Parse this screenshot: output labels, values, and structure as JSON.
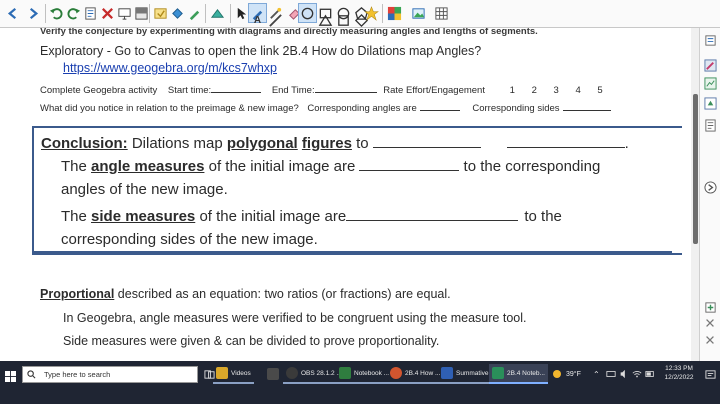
{
  "toolbar": {
    "icons": [
      "back-icon",
      "forward-icon",
      "undo-icon",
      "redo-icon",
      "page-icon",
      "delete-icon",
      "display-icon",
      "screen-shade-icon",
      "insert-icon",
      "select-icon",
      "fill-icon",
      "pen-icon",
      "text-icon",
      "shapes-icon",
      "lines-icon",
      "eraser-icon",
      "ellipse-icon",
      "rectangle-icon",
      "circle-icon",
      "pentagon-icon",
      "star-icon",
      "color-icon",
      "image-icon",
      "table-icon"
    ]
  },
  "document": {
    "line1": "Verify the conjecture by experimenting with diagrams and directly measuring angles and lengths of segments.",
    "line2": "Exploratory - Go to Canvas to open the link 2B.4 How do Dilations map Angles?",
    "link": "https://www.geogebra.org/m/kcs7whxp",
    "line3": {
      "activity": "Complete Geogebra activity",
      "start": "Start time:",
      "end": "End Time:",
      "effort": "Rate Effort/Engagement",
      "ratings": [
        "1",
        "2",
        "3",
        "4",
        "5"
      ]
    },
    "line4": {
      "question": "What did you notice in relation to the preimage & new image?",
      "angles": "Corresponding angles are",
      "sides": "Corresponding sides"
    },
    "conclusion": {
      "label": "Conclusion:",
      "t1": "Dilations map",
      "t2": "polygonal",
      "t3": "figures",
      "t4": "to",
      "row2_a": "The",
      "row2_b": "angle measures",
      "row2_c": "of the initial image are",
      "row2_d": "to the corresponding",
      "row3": "angles of the new image.",
      "row4_a": "The",
      "row4_b": "side measures",
      "row4_c": "of the initial image are",
      "row4_d": "to the",
      "row5": "corresponding sides of the new image."
    },
    "proportional": {
      "term": "Proportional",
      "def": "described as an equation:   two ratios (or fractions) are equal.",
      "line2": "In Geogebra, angle measures were verified to be congruent using the measure tool.",
      "line3": "Side measures were given & can be divided to prove proportionality."
    }
  },
  "taskbar": {
    "search_placeholder": "Type here to search",
    "apps": [
      {
        "label": "Videos",
        "color": "#d9a72a"
      },
      {
        "label": "OBS 28.1.2 ...",
        "color": "#3a3a3a"
      },
      {
        "label": "Notebook ...",
        "color": "#2f7d3f"
      },
      {
        "label": "2B.4 How ...",
        "color": "#d2552f"
      },
      {
        "label": "Summative...",
        "color": "#2f5fb3"
      },
      {
        "label": "2B.4 Noteb...",
        "color": "#2a8f5a"
      }
    ],
    "weather": "39°F",
    "time": "12:33 PM",
    "date": "12/2/2022"
  }
}
